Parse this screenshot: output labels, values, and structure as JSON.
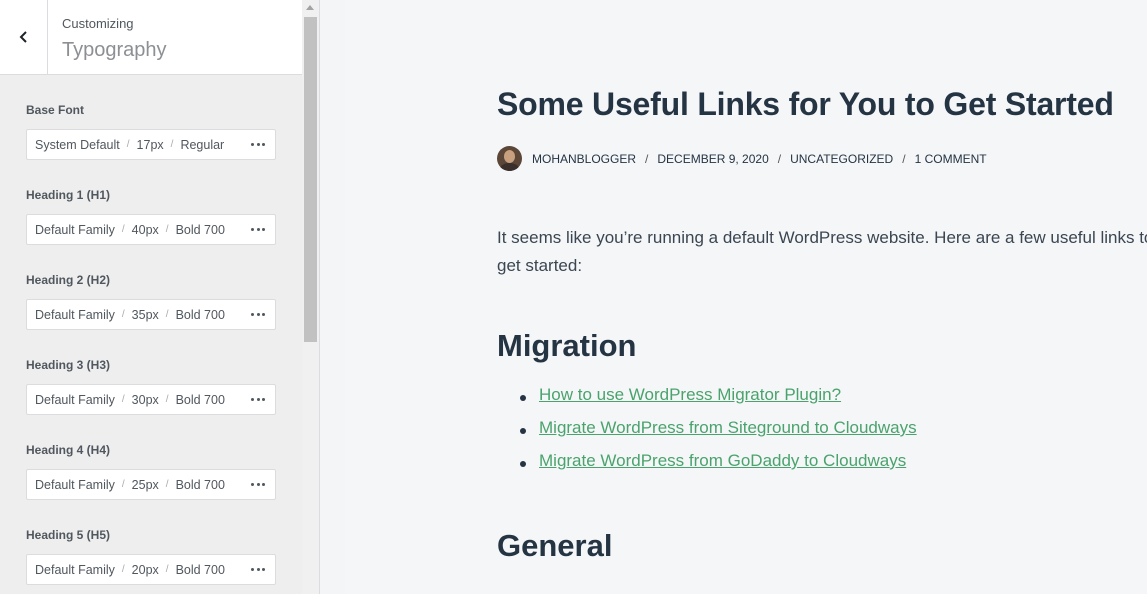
{
  "sidebar": {
    "breadcrumb": "Customizing",
    "title": "Typography",
    "back_icon": "chevron-left-icon",
    "controls": [
      {
        "label": "Base Font",
        "family": "System Default",
        "size": "17px",
        "weight": "Regular"
      },
      {
        "label": "Heading 1 (H1)",
        "family": "Default Family",
        "size": "40px",
        "weight": "Bold 700"
      },
      {
        "label": "Heading 2 (H2)",
        "family": "Default Family",
        "size": "35px",
        "weight": "Bold 700"
      },
      {
        "label": "Heading 3 (H3)",
        "family": "Default Family",
        "size": "30px",
        "weight": "Bold 700"
      },
      {
        "label": "Heading 4 (H4)",
        "family": "Default Family",
        "size": "25px",
        "weight": "Bold 700"
      },
      {
        "label": "Heading 5 (H5)",
        "family": "Default Family",
        "size": "20px",
        "weight": "Bold 700"
      }
    ],
    "separator": "/"
  },
  "preview": {
    "post_title": "Some Useful Links for You to Get Started",
    "meta": {
      "author": "MOHANBLOGGER",
      "date": "DECEMBER 9, 2020",
      "category": "UNCATEGORIZED",
      "comments": "1 COMMENT",
      "separator": "/"
    },
    "intro": "It seems like you’re running a default WordPress website. Here are a few useful links to get started:",
    "section_migration": "Migration",
    "migration_links": [
      "How to use WordPress Migrator Plugin?",
      "Migrate WordPress from Siteground to Cloudways",
      "Migrate WordPress from GoDaddy to Cloudways"
    ],
    "section_general": "General"
  },
  "colors": {
    "heading": "#253443",
    "link": "#4aa36d",
    "sidebar_bg": "#eeeeee"
  }
}
